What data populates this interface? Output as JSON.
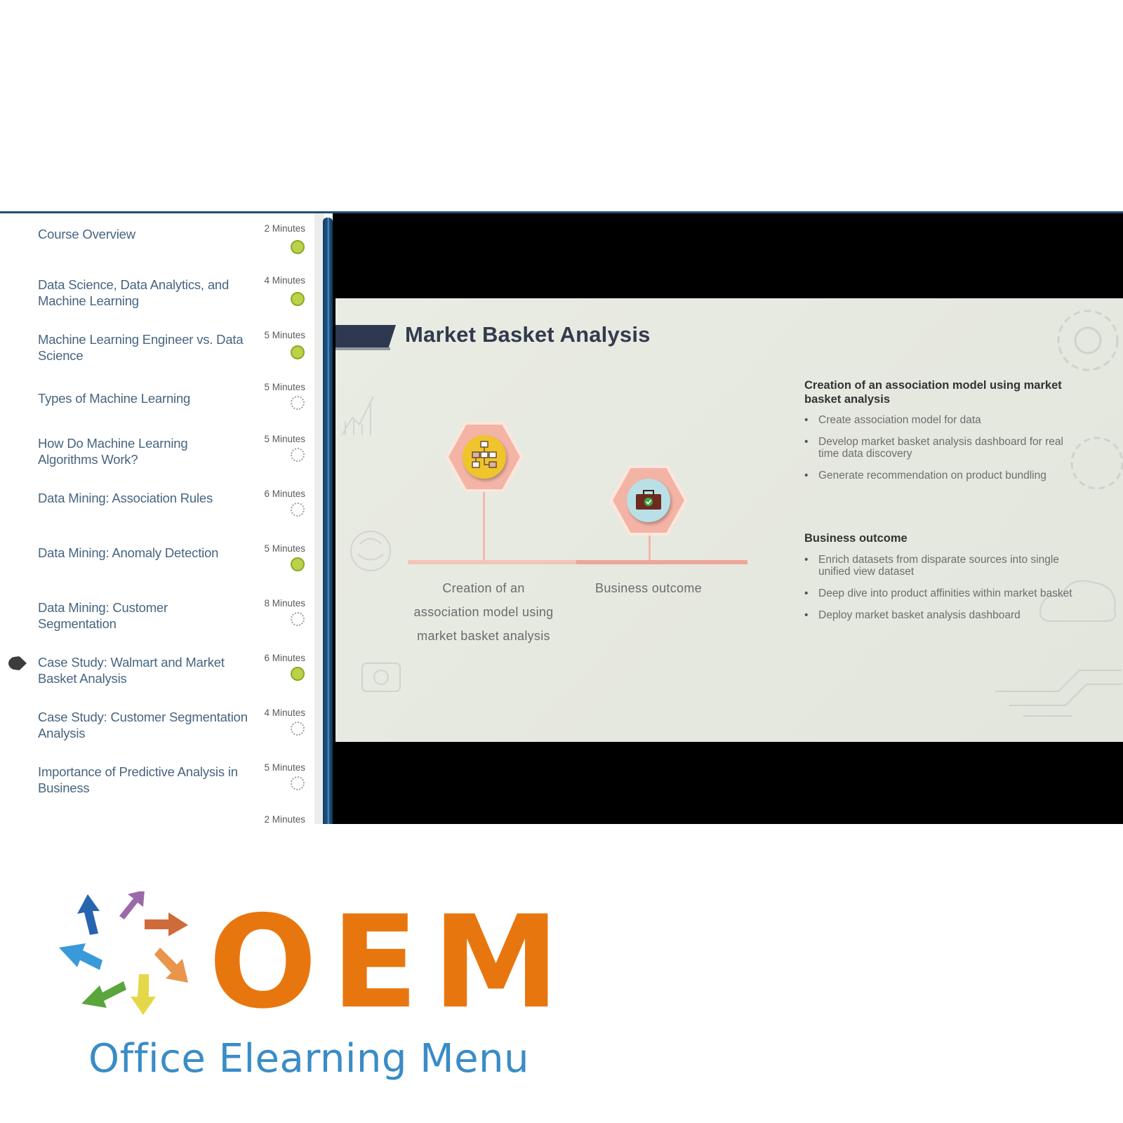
{
  "sidebar": {
    "items": [
      {
        "title": "Course Overview",
        "duration": "2 Minutes",
        "status": "completed"
      },
      {
        "title": "Data Science, Data Analytics, and Machine Learning",
        "duration": "4 Minutes",
        "status": "completed"
      },
      {
        "title": "Machine Learning Engineer vs. Data Science",
        "duration": "5 Minutes",
        "status": "completed"
      },
      {
        "title": "Types of Machine Learning",
        "duration": "5 Minutes",
        "status": "not-started"
      },
      {
        "title": "How Do Machine Learning Algorithms Work?",
        "duration": "5 Minutes",
        "status": "not-started"
      },
      {
        "title": "Data Mining: Association Rules",
        "duration": "6 Minutes",
        "status": "not-started"
      },
      {
        "title": "Data Mining: Anomaly Detection",
        "duration": "5 Minutes",
        "status": "completed"
      },
      {
        "title": "Data Mining: Customer Segmentation",
        "duration": "8 Minutes",
        "status": "not-started"
      },
      {
        "title": "Case Study: Walmart and Market Basket Analysis",
        "duration": "6 Minutes",
        "status": "completed",
        "current": true
      },
      {
        "title": "Case Study: Customer Segmentation Analysis",
        "duration": "4 Minutes",
        "status": "not-started"
      },
      {
        "title": "Importance of Predictive Analysis in Business",
        "duration": "5 Minutes",
        "status": "not-started"
      },
      {
        "title": "",
        "duration": "2 Minutes",
        "status": ""
      }
    ]
  },
  "slide": {
    "title": "Market Basket Analysis",
    "nodes": [
      {
        "label": "Creation of an association model using market basket analysis",
        "icon": "hierarchy-icon"
      },
      {
        "label": "Business outcome",
        "icon": "briefcase-check-icon"
      }
    ],
    "sections": [
      {
        "heading": "Creation of an association model using market basket analysis",
        "bullets": [
          "Create association model for data",
          "Develop market basket analysis dashboard for real time data discovery",
          "Generate recommendation on product bundling"
        ]
      },
      {
        "heading": "Business outcome",
        "bullets": [
          "Enrich datasets from disparate sources into single unified view dataset",
          "Deep dive into product affinities within market basket",
          "Deploy market basket analysis dashboard"
        ]
      }
    ]
  },
  "logo": {
    "brand": "OEM",
    "tagline": "Office Elearning Menu"
  },
  "colors": {
    "completed": "#b9d247",
    "brand_orange": "#e8760f",
    "brand_blue": "#3a8cc6",
    "sidebar_text": "#476580",
    "scrollbar": "#1e5585"
  }
}
